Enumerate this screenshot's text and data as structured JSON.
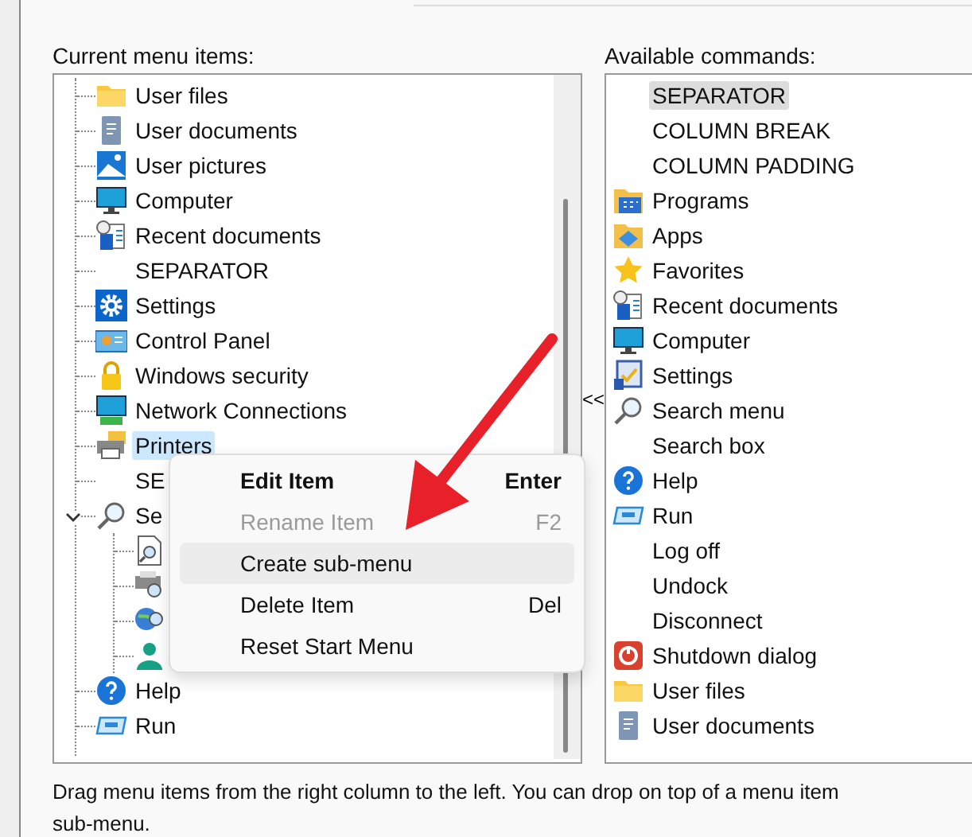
{
  "current_menu_items": {
    "label": "Current menu items:",
    "items": [
      {
        "kind": "folder",
        "label": "User files",
        "selected": false
      },
      {
        "kind": "document",
        "label": "User documents",
        "selected": false
      },
      {
        "kind": "picture",
        "label": "User pictures",
        "selected": false
      },
      {
        "kind": "monitor",
        "label": "Computer",
        "selected": false
      },
      {
        "kind": "recent",
        "label": "Recent documents",
        "selected": false
      },
      {
        "kind": "none",
        "label": "SEPARATOR",
        "selected": false
      },
      {
        "kind": "gear",
        "label": "Settings",
        "selected": false
      },
      {
        "kind": "control-panel",
        "label": "Control Panel",
        "selected": false
      },
      {
        "kind": "lock",
        "label": "Windows security",
        "selected": false
      },
      {
        "kind": "network",
        "label": "Network Connections",
        "selected": false
      },
      {
        "kind": "printer",
        "label": "Printers",
        "selected": true
      },
      {
        "kind": "none",
        "label": "SE",
        "selected": false
      },
      {
        "kind": "search",
        "label": "Se",
        "selected": false,
        "expanded": true,
        "children": [
          {
            "kind": "doc-search"
          },
          {
            "kind": "printer-search"
          },
          {
            "kind": "globe-search"
          },
          {
            "kind": "person"
          }
        ]
      },
      {
        "kind": "help",
        "label": "Help",
        "selected": false
      },
      {
        "kind": "run",
        "label": "Run",
        "selected": false
      }
    ]
  },
  "context_menu": [
    {
      "label": "Edit Item",
      "shortcut": "Enter",
      "bold": true,
      "disabled": false,
      "highlighted": false
    },
    {
      "label": "Rename Item",
      "shortcut": "F2",
      "bold": false,
      "disabled": true,
      "highlighted": false
    },
    {
      "label": "Create sub-menu",
      "bold": false,
      "disabled": false,
      "highlighted": true
    },
    {
      "label": "Delete Item",
      "shortcut": "Del",
      "bold": false,
      "disabled": false,
      "highlighted": false
    },
    {
      "label": "Reset Start Menu",
      "bold": false,
      "disabled": false,
      "highlighted": false
    }
  ],
  "move_button": "<<",
  "available_commands": {
    "label": "Available commands:",
    "items": [
      {
        "kind": "none",
        "label": "SEPARATOR",
        "selected": true
      },
      {
        "kind": "none",
        "label": "COLUMN BREAK",
        "selected": false
      },
      {
        "kind": "none",
        "label": "COLUMN PADDING",
        "selected": false
      },
      {
        "kind": "programs",
        "label": "Programs",
        "selected": false
      },
      {
        "kind": "apps",
        "label": "Apps",
        "selected": false
      },
      {
        "kind": "star",
        "label": "Favorites",
        "selected": false
      },
      {
        "kind": "recent",
        "label": "Recent documents",
        "selected": false
      },
      {
        "kind": "monitor",
        "label": "Computer",
        "selected": false
      },
      {
        "kind": "settings-check",
        "label": "Settings",
        "selected": false
      },
      {
        "kind": "search",
        "label": "Search menu",
        "selected": false
      },
      {
        "kind": "none",
        "label": "Search box",
        "selected": false
      },
      {
        "kind": "help",
        "label": "Help",
        "selected": false
      },
      {
        "kind": "run",
        "label": "Run",
        "selected": false
      },
      {
        "kind": "none",
        "label": "Log off",
        "selected": false
      },
      {
        "kind": "none",
        "label": "Undock",
        "selected": false
      },
      {
        "kind": "none",
        "label": "Disconnect",
        "selected": false
      },
      {
        "kind": "shutdown",
        "label": "Shutdown dialog",
        "selected": false
      },
      {
        "kind": "folder",
        "label": "User files",
        "selected": false
      },
      {
        "kind": "document",
        "label": "User documents",
        "selected": false
      }
    ]
  },
  "hint_lines": [
    "Drag menu items from the right column to the left. You can drop on top of a menu item",
    "sub-menu."
  ]
}
